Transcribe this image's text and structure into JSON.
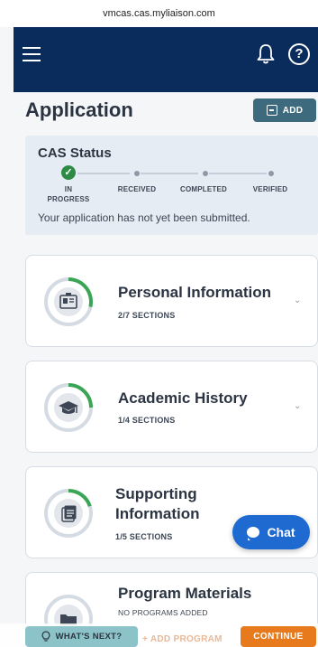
{
  "browser": {
    "url": "vmcas.cas.myliaison.com"
  },
  "header": {
    "menu_icon": "hamburger-icon",
    "notifications_icon": "bell-icon",
    "help_icon": "help-icon",
    "help_glyph": "?"
  },
  "page": {
    "title": "Application",
    "add_label": "ADD"
  },
  "cas_status": {
    "title": "CAS Status",
    "steps": [
      {
        "label_line1": "IN",
        "label_line2": "PROGRESS",
        "state": "done"
      },
      {
        "label_line1": "RECEIVED",
        "label_line2": "",
        "state": "pending"
      },
      {
        "label_line1": "COMPLETED",
        "label_line2": "",
        "state": "pending"
      },
      {
        "label_line1": "VERIFIED",
        "label_line2": "",
        "state": "pending"
      }
    ],
    "message": "Your application has not yet been submitted."
  },
  "cards": [
    {
      "title": "Personal Information",
      "subtitle": "2/7 SECTIONS",
      "progress": 0.286,
      "icon": "id-card-icon"
    },
    {
      "title": "Academic History",
      "subtitle": "1/4 SECTIONS",
      "progress": 0.25,
      "icon": "graduation-cap-icon"
    },
    {
      "title_line1": "Supporting",
      "title_line2": "Information",
      "subtitle": "1/5 SECTIONS",
      "progress": 0.2,
      "icon": "documents-icon"
    },
    {
      "title": "Program Materials",
      "subtitle": "NO PROGRAMS ADDED",
      "progress": 0,
      "icon": "folder-icon"
    }
  ],
  "chat": {
    "label": "Chat"
  },
  "footer": {
    "whats_next": "WHAT'S NEXT?",
    "add_program": "+ ADD PROGRAM",
    "continue": "CONTINUE"
  },
  "colors": {
    "nav": "#0a2c5c",
    "progress": "#3aa655",
    "continue": "#e67a1c",
    "chat": "#1f6ad1"
  }
}
